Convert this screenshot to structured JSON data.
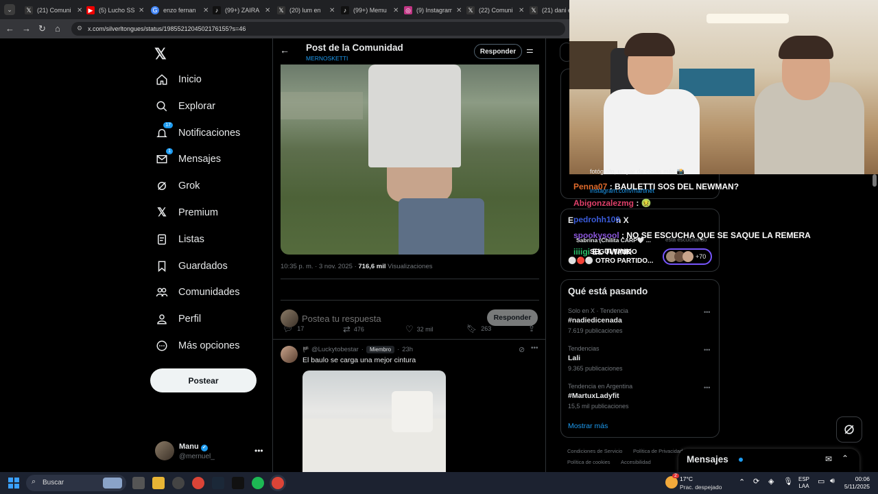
{
  "browser": {
    "tabs": [
      {
        "label": "(21) Comuni",
        "color": "#333"
      },
      {
        "label": "(5) Lucho SS",
        "color": "#e00"
      },
      {
        "label": "enzo fernan",
        "color": "#4285f4"
      },
      {
        "label": "(99+) ZAIRA",
        "color": "#111"
      },
      {
        "label": "(20) lum en",
        "color": "#333"
      },
      {
        "label": "(99+) Memu",
        "color": "#111"
      },
      {
        "label": "(9) Instagram",
        "color": "#c13584"
      },
      {
        "label": "(22) Comuni",
        "color": "#333"
      },
      {
        "label": "(21) dani en",
        "color": "#333"
      }
    ],
    "url": "x.com/silverltongues/status/1985521204502176155?s=46"
  },
  "nav": {
    "items": [
      {
        "label": "Inicio",
        "icon": "home-icon"
      },
      {
        "label": "Explorar",
        "icon": "search-icon"
      },
      {
        "label": "Notificaciones",
        "icon": "bell-icon",
        "badge": "17"
      },
      {
        "label": "Mensajes",
        "icon": "mail-icon",
        "badge": "1"
      },
      {
        "label": "Grok",
        "icon": "grok-icon"
      },
      {
        "label": "Premium",
        "icon": "x-logo-icon"
      },
      {
        "label": "Listas",
        "icon": "list-icon"
      },
      {
        "label": "Guardados",
        "icon": "bookmark-icon"
      },
      {
        "label": "Comunidades",
        "icon": "people-icon"
      },
      {
        "label": "Perfil",
        "icon": "person-icon"
      },
      {
        "label": "Más opciones",
        "icon": "more-circle-icon"
      }
    ],
    "post_label": "Postear",
    "account": {
      "name": "Manu",
      "handle": "@mernuel_"
    }
  },
  "header": {
    "title": "Post de la Comunidad",
    "subtitle": "MERNOSKETTI",
    "reply_label": "Responder"
  },
  "post": {
    "time": "10:35 p. m.",
    "date": "3 nov. 2025",
    "views_count": "716,6 mil",
    "views_label": "Visualizaciones",
    "replies": "17",
    "reposts": "476",
    "likes": "32 mil",
    "bookmarks": "263"
  },
  "composer": {
    "placeholder": "Postea tu respuesta",
    "button": "Responder"
  },
  "reply": {
    "handle": "@Luckytobestar",
    "role": "Miembro",
    "age": "23h",
    "text": "El baulo se carga una mejor cintura"
  },
  "trends": {
    "title": "Qué está pasando",
    "items": [
      {
        "context": "Solo en X · Tendencia",
        "name": "#nadiedicenada",
        "count": "7.619 publicaciones"
      },
      {
        "context": "Tendencias",
        "name": "Lali",
        "count": "9.365 publicaciones"
      },
      {
        "context": "Tendencia en Argentina",
        "name": "#MartuxLadyfit",
        "count": "15,5 mil publicaciones"
      }
    ],
    "more": "Mostrar más"
  },
  "footer_links": [
    "Condiciones de Servicio",
    "Política de Privacidad",
    "Política de cookies",
    "Accesibilidad"
  ],
  "messages_drawer": {
    "title": "Mensajes"
  },
  "spaces": {
    "heading_partial": "E",
    "heading_x": "n X",
    "host": "Sabrina (Chilita CARP🤍 ...",
    "listening": "está escuchando",
    "listeners_extra": "+70",
    "line1": "fotógrafo, un par de cosas más 📸",
    "link": "instagram.com/martinet"
  },
  "stream_chat": [
    {
      "user": "Penna07",
      "sep": " : ",
      "msg": "BAULETTI SOS DEL NEWMAN?",
      "color": "#e06a2b"
    },
    {
      "user": "Abigonzalezmg",
      "sep": " : ",
      "msg": "🤢",
      "color": "#e0406a"
    },
    {
      "user": "pedrohh100",
      "sep": " ",
      "msg": "",
      "color": "#3a5bd9"
    },
    {
      "user": "spookysool",
      "sep": " : ",
      "msg": "NO SE ESCUCHA QUE SE SAQUE LA REMERA",
      "color": "#8a55d9"
    },
    {
      "user": "iiiigi",
      "sep": " ",
      "msg": "EL TWINK",
      "color": "#2ac06a"
    },
    {
      "user": "",
      "sep": "",
      "msg": "SEGUI TANDO",
      "color": "#fff"
    },
    {
      "user": "",
      "sep": "",
      "msg": "⚪🔴⚪ OTRO PARTIDO...",
      "color": "#fff"
    }
  ],
  "taskbar": {
    "search_placeholder": "Buscar",
    "weather_temp": "17°C",
    "weather_desc": "Prac. despejado",
    "lang": "ESP",
    "lang2": "LAA",
    "time": "00:06",
    "date": "5/11/2025",
    "weather_badge": "2"
  }
}
